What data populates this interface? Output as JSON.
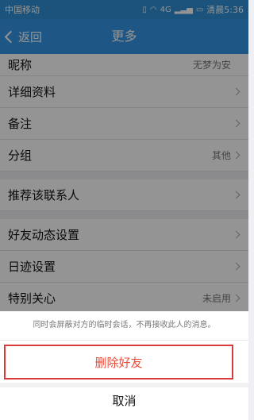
{
  "status_bar": {
    "carrier": "中国移动",
    "network": "4G",
    "time": "清晨5:36"
  },
  "nav": {
    "back_label": "返回",
    "title": "更多"
  },
  "rows": [
    {
      "label": "昵称",
      "value": "无梦为安"
    },
    {
      "label": "详细资料",
      "value": ""
    },
    {
      "label": "备注",
      "value": ""
    },
    {
      "label": "分组",
      "value": "其他"
    },
    {
      "label": "推荐该联系人",
      "value": ""
    },
    {
      "label": "好友动态设置",
      "value": ""
    },
    {
      "label": "日迹设置",
      "value": ""
    },
    {
      "label": "特别关心",
      "value": "未启用"
    }
  ],
  "sheet": {
    "message": "同时会屏蔽对方的临时会话，不再接收此人的消息。",
    "delete_label": "删除好友",
    "cancel_label": "取消"
  },
  "colors": {
    "accent": "#3497e5",
    "danger": "#e84b3a",
    "highlight_border": "#d93a3a"
  }
}
